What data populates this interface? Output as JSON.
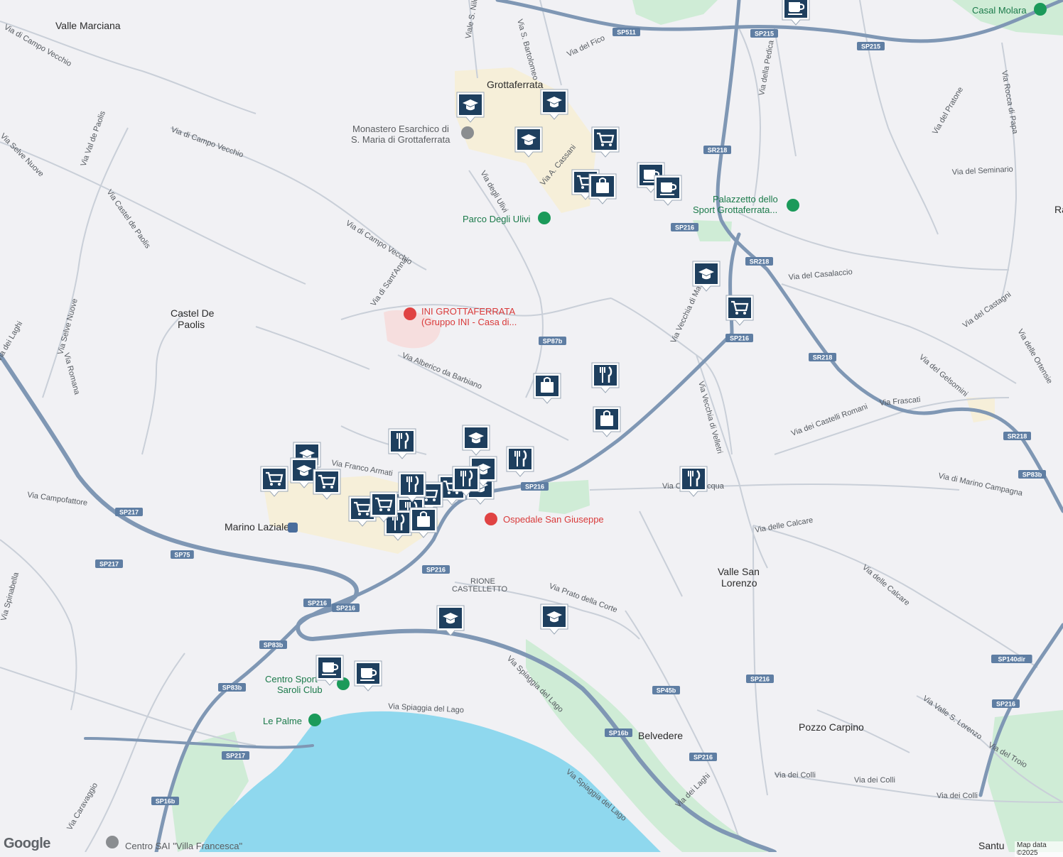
{
  "places": [
    {
      "name": "valle-marciana",
      "text": "Valle Marciana"
    },
    {
      "name": "grottaferrata",
      "text": "Grottaferrata"
    },
    {
      "name": "casal-molara",
      "text": "Casal Molara"
    },
    {
      "name": "castel-de-paolis-1",
      "text": "Castel De"
    },
    {
      "name": "castel-de-paolis-2",
      "text": "Paolis"
    },
    {
      "name": "valle-san-lorenzo-1",
      "text": "Valle San"
    },
    {
      "name": "valle-san-lorenzo-2",
      "text": "Lorenzo"
    },
    {
      "name": "belvedere",
      "text": "Belvedere"
    },
    {
      "name": "pozzo-carpino",
      "text": "Pozzo Carpino"
    },
    {
      "name": "rione-castelletto-1",
      "text": "RIONE"
    },
    {
      "name": "rione-castelletto-2",
      "text": "CASTELLETTO"
    },
    {
      "name": "marino-laziale",
      "text": "Marino Laziale"
    },
    {
      "name": "santu",
      "text": "Santu"
    },
    {
      "name": "ra",
      "text": "Ra"
    }
  ],
  "pois": [
    {
      "name": "monastero-1",
      "text": "Monastero Esarchico di",
      "cls": "poi-gray"
    },
    {
      "name": "monastero-2",
      "text": "S. Maria di Grottaferrata",
      "cls": "poi-gray"
    },
    {
      "name": "parco-ulivi",
      "text": "Parco Degli Ulivi",
      "cls": "poi-green"
    },
    {
      "name": "palazzetto-1",
      "text": "Palazzetto dello",
      "cls": "poi-green"
    },
    {
      "name": "palazzetto-2",
      "text": "Sport Grottaferrata...",
      "cls": "poi-green"
    },
    {
      "name": "ini-1",
      "text": "INI GROTTAFERRATA",
      "cls": "poi-red"
    },
    {
      "name": "ini-2",
      "text": "(Gruppo INI - Casa di...",
      "cls": "poi-red"
    },
    {
      "name": "ospedale",
      "text": "Ospedale San Giuseppe",
      "cls": "poi-red"
    },
    {
      "name": "centro-sport-1",
      "text": "Centro Sport",
      "cls": "poi-green"
    },
    {
      "name": "centro-sport-2",
      "text": "Saroli Club",
      "cls": "poi-green"
    },
    {
      "name": "le-palme",
      "text": "Le Palme",
      "cls": "poi-green"
    },
    {
      "name": "centro-sai",
      "text": "Centro SAI \"Villa Francesca\"",
      "cls": "poi-gray"
    }
  ],
  "streets": [
    {
      "text": "Via di Campo Vecchio",
      "rot": 30
    },
    {
      "text": "Viale S. Nilo",
      "rot": -80
    },
    {
      "text": "Via S. Bartolomeo",
      "rot": 75
    },
    {
      "text": "Via del Fico",
      "rot": -25
    },
    {
      "text": "Via della Pedica",
      "rot": -80
    },
    {
      "text": "Via del Pratone",
      "rot": -60
    },
    {
      "text": "Via Rocca di Papa",
      "rot": 80
    },
    {
      "text": "Via Val de Paolis",
      "rot": -70
    },
    {
      "text": "Via di Campo Vecchio",
      "rot": 20
    },
    {
      "text": "Via Castel de Paolis",
      "rot": 55
    },
    {
      "text": "Via degli Ulivi",
      "rot": 60
    },
    {
      "text": "Via A. Cassani",
      "rot": -50
    },
    {
      "text": "Via del Seminario",
      "rot": -3
    },
    {
      "text": "Via di Campo Vecchio",
      "rot": 32
    },
    {
      "text": "Via di Sant'Anna",
      "rot": -55
    },
    {
      "text": "Via del Casalaccio",
      "rot": -5
    },
    {
      "text": "Via del Castagni",
      "rot": -35
    },
    {
      "text": "Via delle Ortensie",
      "rot": 60
    },
    {
      "text": "Via Selve Nuove",
      "rot": -75
    },
    {
      "text": "Via Romana",
      "rot": 75
    },
    {
      "text": "Via Alberico da Barbiano",
      "rot": 22
    },
    {
      "text": "Via Vecchia di Marino",
      "rot": -65
    },
    {
      "text": "Via del Gelsomini",
      "rot": 40
    },
    {
      "text": "Via dei Castelli Romani",
      "rot": -20
    },
    {
      "text": "Via Frascati",
      "rot": -5
    },
    {
      "text": "Via Vecchia di Velletri",
      "rot": 75
    },
    {
      "text": "Via Franco Armati",
      "rot": 10
    },
    {
      "text": "Via Campofattore",
      "rot": 8
    },
    {
      "text": "Via Cave d'Acqua",
      "rot": 0
    },
    {
      "text": "Via di Marino Campagna",
      "rot": 12
    },
    {
      "text": "Via delle Calcare",
      "rot": -10
    },
    {
      "text": "Via delle Calcare",
      "rot": 40
    },
    {
      "text": "Via Spinabella",
      "rot": -75
    },
    {
      "text": "Via Prato della Corte",
      "rot": 20
    },
    {
      "text": "Via Spiaggia del Lago",
      "rot": 45
    },
    {
      "text": "Via Spiaggia del Lago",
      "rot": 3
    },
    {
      "text": "Via Spiaggia del Lago",
      "rot": 40
    },
    {
      "text": "Via Valle S. Lorenzo",
      "rot": 35
    },
    {
      "text": "Via del Troio",
      "rot": 30
    },
    {
      "text": "Via dei Colli",
      "rot": 0
    },
    {
      "text": "Via dei Colli",
      "rot": 0
    },
    {
      "text": "Via dei Colli",
      "rot": 0
    },
    {
      "text": "Via dei Laghi",
      "rot": -45
    },
    {
      "text": "Via Caravaggio",
      "rot": -60
    },
    {
      "text": "Via Selve Nuove",
      "rot": 45
    },
    {
      "text": "Via dei Laghi",
      "rot": -60
    }
  ],
  "shields": [
    "SP511",
    "SP215",
    "SP215",
    "SR218",
    "SP216",
    "SR218",
    "SP87b",
    "SP216",
    "SR218",
    "SR218",
    "SP83b",
    "SP217",
    "SP75",
    "SP216",
    "SP217",
    "SP216",
    "SP216",
    "SP216",
    "SP83b",
    "SP83b",
    "SP140dir",
    "SP216",
    "SP217",
    "SP16b",
    "SP16b",
    "SP45b",
    "SP216",
    "SP216"
  ],
  "markers": [
    "school",
    "school",
    "school",
    "shop-cart",
    "shop-cart",
    "shopping-bag",
    "cafe",
    "cafe",
    "cafe",
    "school",
    "shop-cart",
    "shopping-bag",
    "restaurant",
    "shopping-bag",
    "restaurant",
    "school",
    "restaurant",
    "restaurant",
    "school",
    "school",
    "shop-cart",
    "shop-cart",
    "shop-cart",
    "shop-cart",
    "shop-cart",
    "shop-cart",
    "restaurant",
    "restaurant",
    "shopping-bag",
    "school",
    "restaurant",
    "school",
    "school",
    "cafe",
    "cafe",
    "school",
    "shop-cart",
    "restaurant"
  ],
  "footer": {
    "logo": "Google",
    "attribution": "Map data ©2025"
  },
  "colors": {
    "land": "#f1f1f4",
    "water": "#8fd8ee",
    "park": "#cfecd6",
    "highway": "#7f97b4",
    "road": "#c9cfd8",
    "urban": "#f6efd9",
    "marker": "#1e3f5e"
  }
}
